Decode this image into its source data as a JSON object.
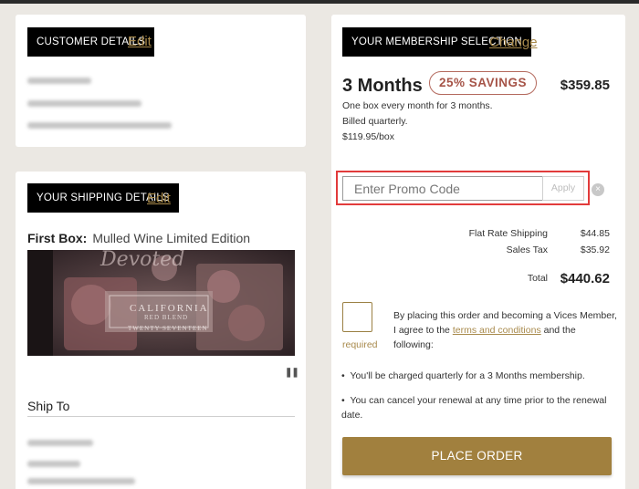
{
  "customer": {
    "tag": "CUSTOMER DETAILS",
    "edit": "Edit"
  },
  "shipping": {
    "tag": "YOUR SHIPPING DETAILS",
    "edit": "Edit",
    "first_box_label": "First Box:",
    "first_box_value": "Mulled Wine Limited Edition",
    "ship_to": "Ship To",
    "image_text": [
      "Devoted",
      "CALIFORNIA",
      "RED BLEND",
      "TWENTY SEVENTEEN"
    ]
  },
  "membership": {
    "tag": "YOUR MEMBERSHIP SELECTION",
    "change": "Change",
    "plan": "3 Months",
    "savings": "25% SAVINGS",
    "price": "$359.85",
    "desc": [
      "One box every month for 3 months.",
      "Billed quarterly.",
      "$119.95/box"
    ]
  },
  "promo": {
    "placeholder": "Enter Promo Code",
    "apply": "Apply",
    "clear_icon": "×"
  },
  "summary": {
    "shipping_label": "Flat Rate Shipping",
    "shipping_value": "$44.85",
    "tax_label": "Sales Tax",
    "tax_value": "$35.92",
    "total_label": "Total",
    "total_value": "$440.62"
  },
  "terms": {
    "required": "required",
    "text_before": "By placing this order and becoming a Vices Member, I agree to the",
    "link": "terms and conditions",
    "text_after": "and the following:",
    "bullets": [
      "You'll be charged quarterly for a 3 Months membership.",
      "You can cancel your renewal at any time prior to the renewal date."
    ]
  },
  "place_order": "PLACE ORDER",
  "pause_icon": "pause-icon",
  "colors": {
    "accent": "#a1803e",
    "savings": "#a65448",
    "highlight": "#e23b3b"
  }
}
